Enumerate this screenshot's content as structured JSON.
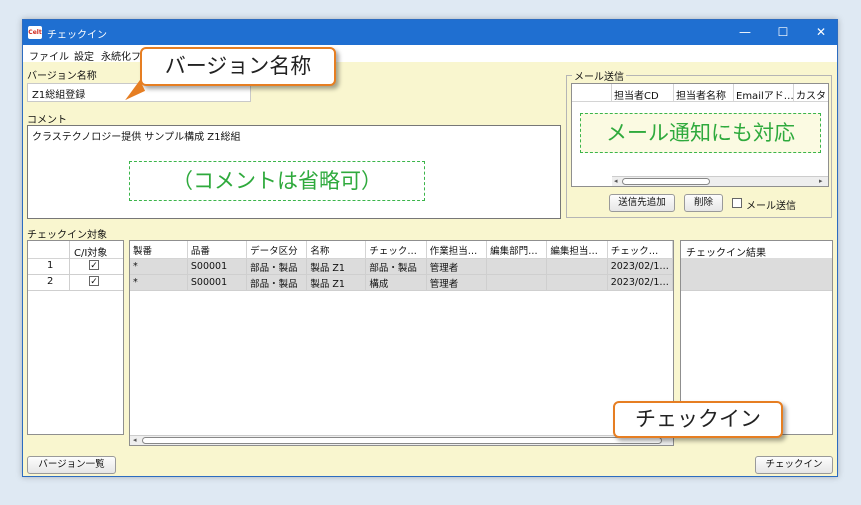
{
  "window": {
    "title": "チェックイン",
    "app_icon": "Celt",
    "minimize": "—",
    "maximize": "☐",
    "close": "✕"
  },
  "menu": [
    "ファイル",
    "設定",
    "永続化フ"
  ],
  "version": {
    "label": "バージョン名称",
    "value": "Z1総組登録"
  },
  "comment": {
    "label": "コメント",
    "value": "クラステクノロジー提供 サンプル構成 Z1総組"
  },
  "mail": {
    "group_label": "メール送信",
    "columns": [
      "担当者CD",
      "担当者名称",
      "Emailアド…",
      "カスタム"
    ],
    "add_button": "送信先追加",
    "delete_button": "削除",
    "checkbox_label": "メール送信"
  },
  "checkin_target": {
    "label": "チェックイン対象",
    "row_header": "C/I対象",
    "rows": [
      {
        "no": "1",
        "checked": "✓"
      },
      {
        "no": "2",
        "checked": "✓"
      }
    ]
  },
  "items": {
    "columns": [
      "製番",
      "品番",
      "データ区分",
      "名称",
      "チェック…",
      "作業担当…",
      "編集部門…",
      "編集担当…",
      "チェック…"
    ],
    "rows": [
      [
        "*",
        "S00001",
        "部品・製品",
        "製品 Z1",
        "部品・製品",
        "管理者",
        "",
        "",
        "2023/02/1…"
      ],
      [
        "*",
        "S00001",
        "部品・製品",
        "製品 Z1",
        "構成",
        "管理者",
        "",
        "",
        "2023/02/1…"
      ]
    ]
  },
  "result": {
    "header": "チェックイン結果"
  },
  "buttons": {
    "version_list": "バージョン一覧",
    "checkin": "チェックイン"
  },
  "annotations": {
    "version_callout": "バージョン名称",
    "mail_callout": "メール通知にも対応",
    "comment_callout": "（コメントは省略可）",
    "checkin_callout": "チェックイン"
  }
}
